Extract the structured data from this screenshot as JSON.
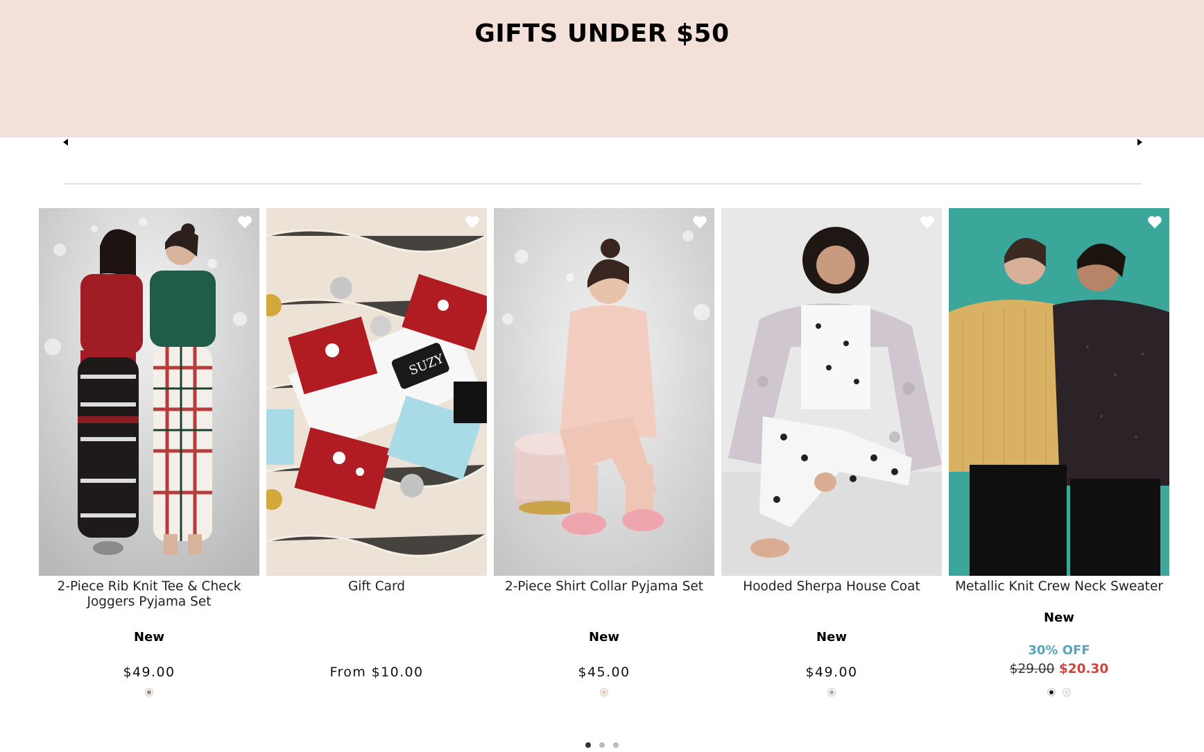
{
  "banner": {
    "title": "GIFTS UNDER $50",
    "bg_color": "#f3e0d9"
  },
  "carousel": {
    "prev_icon": "chevron-left-icon",
    "next_icon": "chevron-right-icon",
    "page_count": 3,
    "active_page": 1
  },
  "products": [
    {
      "name": "2-Piece Rib Knit Tee & Check Joggers Pyjama Set",
      "badge": "New",
      "price": "$49.00",
      "swatches": [
        "#9e8576"
      ]
    },
    {
      "name": "Gift Card",
      "badge": "",
      "price": "From $10.00",
      "swatches": []
    },
    {
      "name": "2-Piece Shirt Collar Pyjama Set",
      "badge": "New",
      "price": "$45.00",
      "swatches": [
        "#f0c9b5"
      ]
    },
    {
      "name": "Hooded Sherpa House Coat",
      "badge": "New",
      "price": "$49.00",
      "swatches": [
        "#a9a6c6"
      ]
    },
    {
      "name": "Metallic Knit Crew Neck Sweater",
      "badge": "New",
      "discount": "30% OFF",
      "old_price": "$29.00",
      "sale_price": "$20.30",
      "swatches": [
        "#1a1a1a",
        "#ece3d9"
      ]
    }
  ],
  "colors": {
    "discount": "#57a4bc",
    "sale_price": "#d0453a",
    "divider": "#e3e3e3"
  }
}
